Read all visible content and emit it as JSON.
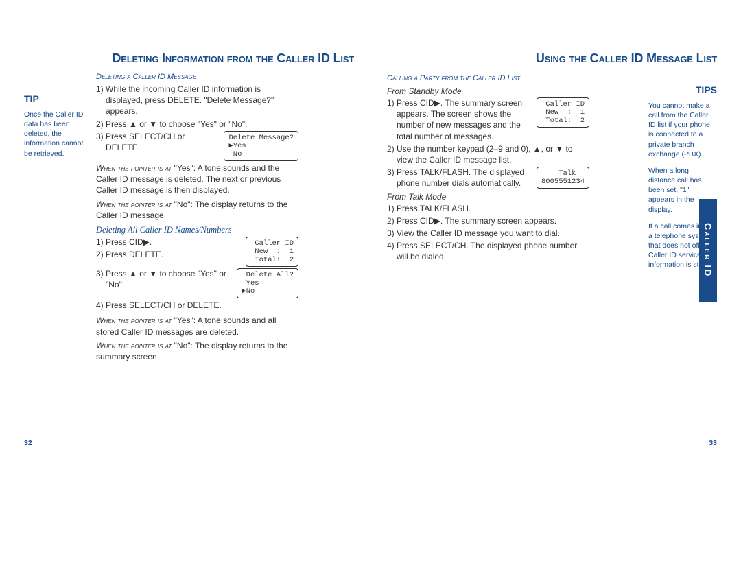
{
  "page_left": {
    "title": "Deleting Information from the Caller ID List",
    "tip_label": "TIP",
    "tip_body": "Once the Caller ID data has been deleted, the information cannot be retrieved.",
    "sect1_hdr": "Deleting a Caller ID Message",
    "s1_1": "1) While the incoming Caller ID information is displayed, press DELETE. \"Delete Message?\" appears.",
    "s1_2": "2) Press ▲ or ▼ to choose \"Yes\" or \"No\".",
    "s1_3": "3) Press SELECT/CH or DELETE.",
    "lcd1": "Delete Message?\n▶Yes\n No",
    "when_yes_1a": "When the pointer is at",
    "when_yes_1b": " \"Yes\": A tone sounds and the Caller ID message is deleted. The next or previous Caller ID message is then displayed.",
    "when_no_1a": "When the pointer is at",
    "when_no_1b": " \"No\": The display returns to the Caller ID message.",
    "sect2_hdr": "Deleting All Caller ID Names/Numbers",
    "s2_1": "1) Press CID▶.",
    "s2_2": "2) Press DELETE.",
    "s2_3": "3) Press ▲ or ▼ to choose \"Yes\" or \"No\".",
    "lcd2": " Caller ID\n New  :  1\n Total:  2",
    "lcd3": " Delete All?\n Yes\n▶No",
    "s2_4": "4) Press SELECT/CH or DELETE.",
    "when_yes_2a": "When the pointer is at",
    "when_yes_2b": " \"Yes\": A tone sounds and all stored Caller ID messages are deleted.",
    "when_no_2a": "When the pointer is at",
    "when_no_2b": " \"No\": The display returns to the summary screen.",
    "page_num": "32"
  },
  "page_right": {
    "title": "Using the Caller ID Message List",
    "tips_label": "TIPS",
    "tip1": "You cannot make a call from the Caller ID list if your phone is connected to a private branch exchange (PBX).",
    "tip2": "When a long distance call has been set, \"1\" appears in the display.",
    "tip3": "If a call comes in via a telephone system that does not offer Caller ID service, no information is stored.",
    "sect1_hdr": "Calling a Party from the Caller ID List",
    "sub1": "From Standby Mode",
    "s1_1": "1) Press CID▶. The summary screen appears. The screen shows the number of new messages and the total number of messages.",
    "lcd1": " Caller ID\n New  :  1\n Total:  2",
    "s1_2": "2) Use the number keypad (2–9 and 0), ▲, or ▼ to view the Caller ID message list.",
    "s1_3": "3) Press TALK/FLASH. The displayed phone number dials automatically.",
    "lcd2": "    Talk\n8005551234",
    "sub2": "From Talk Mode",
    "s2_1": "1) Press TALK/FLASH.",
    "s2_2": "2) Press CID▶. The summary screen appears.",
    "s2_3": "3) View the Caller ID message you want to dial.",
    "s2_4": "4) Press SELECT/CH. The displayed phone number will be dialed.",
    "page_num": "33",
    "side_tab": "Caller ID"
  }
}
